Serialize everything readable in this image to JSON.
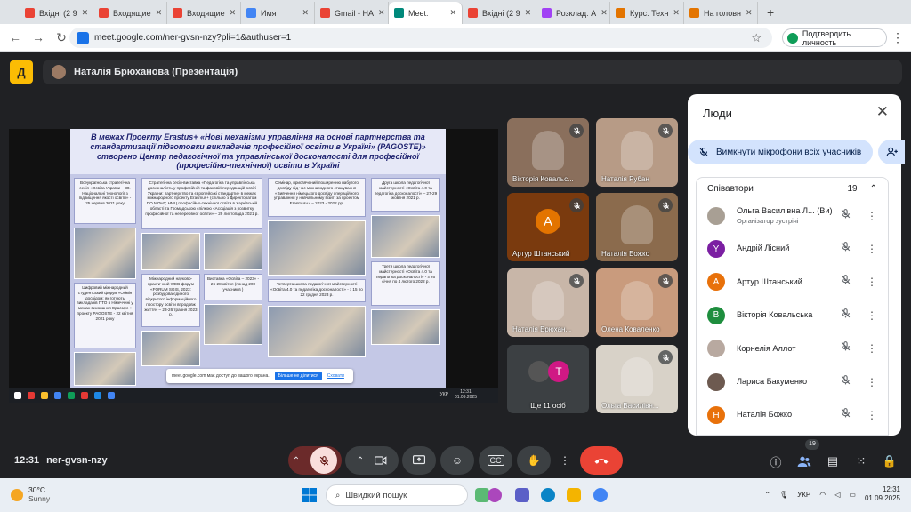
{
  "browser": {
    "tabs": [
      {
        "label": "Вхідні (2 9",
        "icon": "gmail-icon",
        "color": "#ea4335"
      },
      {
        "label": "Входящие",
        "icon": "gmail-icon",
        "color": "#ea4335"
      },
      {
        "label": "Входящие",
        "icon": "gmail-icon",
        "color": "#ea4335"
      },
      {
        "label": "Имя",
        "icon": "google-icon",
        "color": "#4285f4"
      },
      {
        "label": "Gmail - НА",
        "icon": "gmail-icon",
        "color": "#ea4335"
      },
      {
        "label": "Meet:",
        "icon": "meet-icon",
        "color": "#00897b"
      },
      {
        "label": "Вхідні (2 9",
        "icon": "gmail-icon",
        "color": "#ea4335"
      },
      {
        "label": "Розклад: А",
        "icon": "schedule-icon",
        "color": "#a142f4"
      },
      {
        "label": "Курс: Техн",
        "icon": "course-icon",
        "color": "#e37400"
      },
      {
        "label": "На головн",
        "icon": "course-icon",
        "color": "#e37400"
      }
    ],
    "new_tab": "+",
    "url": "meet.google.com/ner-gvsn-nzy?pli=1&authuser=1",
    "verify_label": "Подтвердить личность"
  },
  "meet": {
    "presenter_bar": "Наталія Брюханова (Презентація)",
    "logo_letter": "Д",
    "slide": {
      "title": "В межах Проекту Erastus+ «Нові механізми управління на основі партнерства та стандартизації підготовки викладачів професійної освіти в Україні» (PAGOSTE)» створено Центр педагогічної та управлінської досконалості для професійної (професійно-технічної) освіти в Україні",
      "blocks": [
        "Всеукраїнська стратегічна сесія «Освіта України – 30. Національні технології з підвищення якості освіти» - 25 червня 2021 року",
        "Стратегічна сесія-виставка «Педагогіка та управлінська досконалість у професійній та фаховій передвищій освіті України: партнерство та європейські стандарти» в межах міжнародного проекту Erasmus+ (спільно з Директоратом ПО МОНУ, НМЦ професійно-технічної освіти в Харківській області та Громадською спілкою «Асоціація з розвитку професійної та неперервної освіти» – 29 листопада 2021 р.",
        "Семінар, присвячений поширенню набутого досвіду під час міжнародного стажування «Вивчення німецького досвіду операційного управління у навчальному візиті за проектом Erasmus+» – 2023 - 2022 рр.",
        "Друга школа педагогічної майстерності «Освіта 4.0 та педагогіка досконалості» – 27-29 жовтня 2021 р.",
        "Міжнародний науково-практичний WEB-форум «FORUM SGIS, 2023: розбудова єдиного відкритого інформаційного простору освіти впродовж життя» – 23-26 травня 2023 р.",
        "Виставка «Освіта – 2023» - 26-28 квітня (понад 200 учасників )",
        "Четверта школа педагогічної майстерності «Освіта 4.0 та педагогіка досконалості» - з 15 по 22 грудня 2023 р.",
        "Третя школа педагогічної майстерності «Освіта 4.0 та педагогіка досконалості» - з 26 січня по 4 лютого 2022 р.",
        "Цифровий міжнародний студентський форум «Обмін досвідом: як готують викладачів ПТО в Німеччині у межах виконання Ерасмус + проекту PAGOSTE - 22 квітня 2021 року"
      ],
      "share_alert": "meet.google.com має доступ до вашого екрана.",
      "stop_share": "Більше не ділитися",
      "hide": "Сховати",
      "win_time": "12:31",
      "win_date": "01.09.2025",
      "win_lang": "УКР"
    },
    "tiles": [
      {
        "name": "Вікторія Ковальс...",
        "type": "video",
        "bg": "#8a6f5c"
      },
      {
        "name": "Наталія Рубан",
        "type": "video",
        "bg": "#b79b86"
      },
      {
        "name": "Артур Штанський",
        "type": "avatar",
        "letter": "А",
        "bg": "#7a3a0e"
      },
      {
        "name": "Наталія Божко",
        "type": "video",
        "bg": "#8b6b4d"
      },
      {
        "name": "Наталія Брюхан...",
        "type": "video",
        "bg": "#c8b6a8"
      },
      {
        "name": "Олена Коваленко",
        "type": "video",
        "bg": "#c99b7d"
      },
      {
        "name": "Ще 11 осіб",
        "type": "more",
        "letter": "Т",
        "bg": "#3c4043"
      },
      {
        "name": "Ольга Василівн...",
        "type": "video",
        "bg": "#d8d2c8"
      }
    ]
  },
  "people": {
    "title": "Люди",
    "mute_all": "Вимкнути мікрофони всіх учасників",
    "group": "Співавтори",
    "count": "19",
    "list": [
      {
        "name": "Ольга Василівна Л... (Ви)",
        "sub": "Організатор зустрічі",
        "avatar": "photo",
        "color": "#a89f94",
        "letter": ""
      },
      {
        "name": "Андрій Лісний",
        "sub": "",
        "avatar": "letter",
        "color": "#7b1fa2",
        "letter": "Y"
      },
      {
        "name": "Артур Штанський",
        "sub": "",
        "avatar": "letter",
        "color": "#e8710a",
        "letter": "А"
      },
      {
        "name": "Вікторія Ковальська",
        "sub": "",
        "avatar": "letter",
        "color": "#1e8e3e",
        "letter": "В"
      },
      {
        "name": "Корнелія Аллот",
        "sub": "",
        "avatar": "photo",
        "color": "#b8a9a0",
        "letter": ""
      },
      {
        "name": "Лариса Бакуменко",
        "sub": "",
        "avatar": "photo",
        "color": "#6d5a50",
        "letter": ""
      },
      {
        "name": "Наталія Божко",
        "sub": "",
        "avatar": "letter",
        "color": "#e8710a",
        "letter": "Н"
      }
    ]
  },
  "controls": {
    "time": "12:31",
    "code": "ner-gvsn-nzy",
    "people_badge": "19"
  },
  "taskbar": {
    "temp": "30°C",
    "weather": "Sunny",
    "search": "Швидкий пошук",
    "lang": "УКР",
    "time": "12:31",
    "date": "01.09.2025"
  }
}
